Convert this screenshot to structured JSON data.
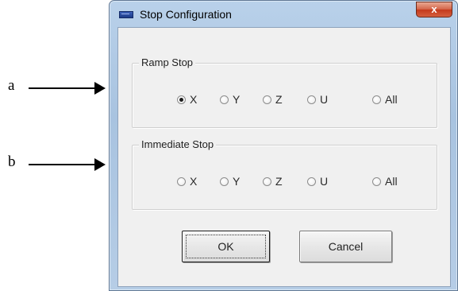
{
  "callouts": [
    {
      "label": "a"
    },
    {
      "label": "b"
    }
  ],
  "window": {
    "title": "Stop Configuration",
    "close_glyph": "x",
    "title_icon": "app-icon"
  },
  "ramp_stop": {
    "title": "Ramp Stop",
    "options": [
      {
        "label": "X",
        "checked": true
      },
      {
        "label": "Y",
        "checked": false
      },
      {
        "label": "Z",
        "checked": false
      },
      {
        "label": "U",
        "checked": false
      },
      {
        "label": "All",
        "checked": false
      }
    ]
  },
  "immediate_stop": {
    "title": "Immediate Stop",
    "options": [
      {
        "label": "X",
        "checked": false
      },
      {
        "label": "Y",
        "checked": false
      },
      {
        "label": "Z",
        "checked": false
      },
      {
        "label": "U",
        "checked": false
      },
      {
        "label": "All",
        "checked": false
      }
    ]
  },
  "buttons": {
    "ok": "OK",
    "cancel": "Cancel"
  }
}
